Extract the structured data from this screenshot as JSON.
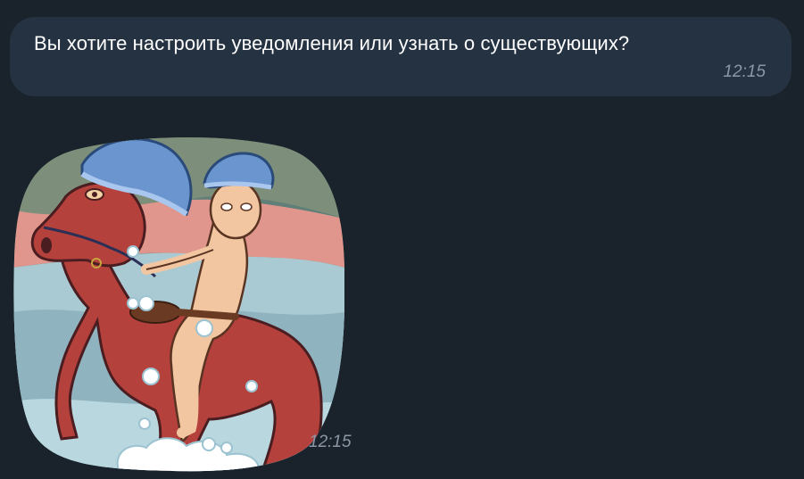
{
  "messages": [
    {
      "text": "Вы хотите настроить уведомления или узнать о существующих?",
      "time": "12:15"
    },
    {
      "type": "sticker",
      "sticker_subject": "man-on-red-horse-in-shower-caps",
      "time": "12:15"
    }
  ],
  "colors": {
    "background": "#1a222c",
    "bubble": "#253242",
    "text": "#ffffff",
    "time": "#8b97a5"
  }
}
